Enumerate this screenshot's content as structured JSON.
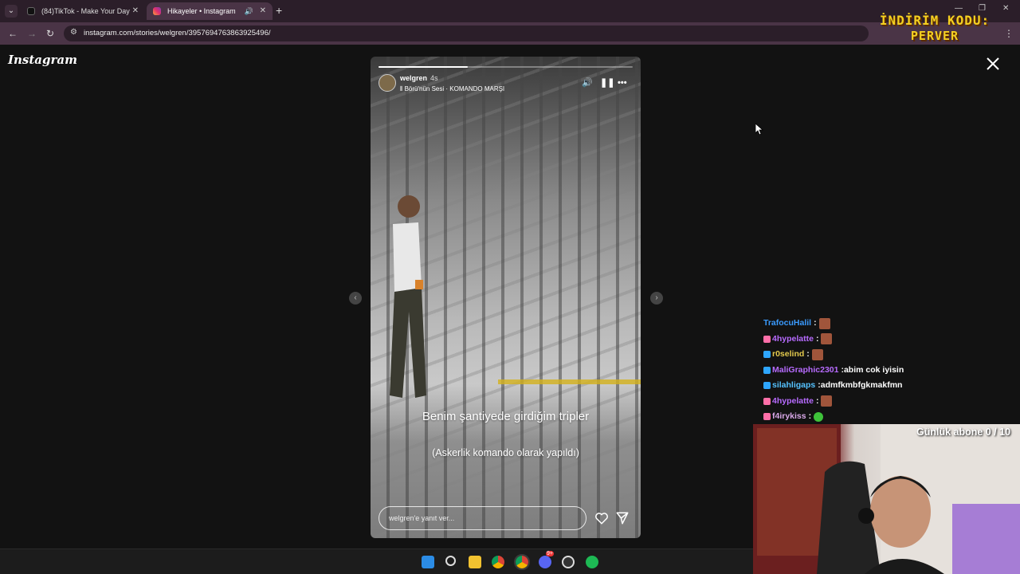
{
  "browser": {
    "tabs": [
      {
        "title": "(84)TikTok - Make Your Day"
      },
      {
        "title": "Hikayeler • Instagram"
      }
    ],
    "url": "instagram.com/stories/welgren/3957694763863925496/"
  },
  "promo": {
    "line1": "İNDİRİM KODU:",
    "line2": "PERVER"
  },
  "instagram": {
    "logo": "Instagram",
    "story": {
      "username": "welgren",
      "time": "4s",
      "audio": "Börü'nün Sesi · KOMANDO MARŞI",
      "progress": 0.35,
      "caption_main": "Benim şantiyede girdiğim tripler",
      "caption_sub": "(Askerlik komando olarak yapıldı)",
      "reply_placeholder": "welgren'e yanıt ver..."
    }
  },
  "chat": [
    {
      "name": "TrafocuHalil",
      "color": "#3a9bff",
      "badge": "",
      "message": ""
    },
    {
      "name": "4hypelatte",
      "color": "#b76bff",
      "badge": "#ff6fa8",
      "message": ""
    },
    {
      "name": "r0selind",
      "color": "#e2c94d",
      "badge": "#2ea6ff",
      "message": ""
    },
    {
      "name": "MaliGraphic2301",
      "color": "#b76bff",
      "badge": "#2ea6ff",
      "message": "abim cok iyisin"
    },
    {
      "name": "silahligaps",
      "color": "#55c2ff",
      "badge": "#2ea6ff",
      "message": "admfkmbfgkmakfmn"
    },
    {
      "name": "4hypelatte",
      "color": "#b76bff",
      "badge": "#ff6fa8",
      "message": ""
    },
    {
      "name": "f4irykiss",
      "color": "#d9a8e8",
      "badge": "#ff6fa8",
      "message": ""
    }
  ],
  "stream": {
    "sub_goal": "Günlük abone 0 / 10"
  },
  "taskbar": {
    "icons": [
      "windows-start-icon",
      "search-icon",
      "file-explorer-icon",
      "chrome-icon",
      "chrome-active-icon",
      "discord-icon",
      "obs-icon",
      "spotify-icon"
    ],
    "discord_badge": "9+"
  }
}
